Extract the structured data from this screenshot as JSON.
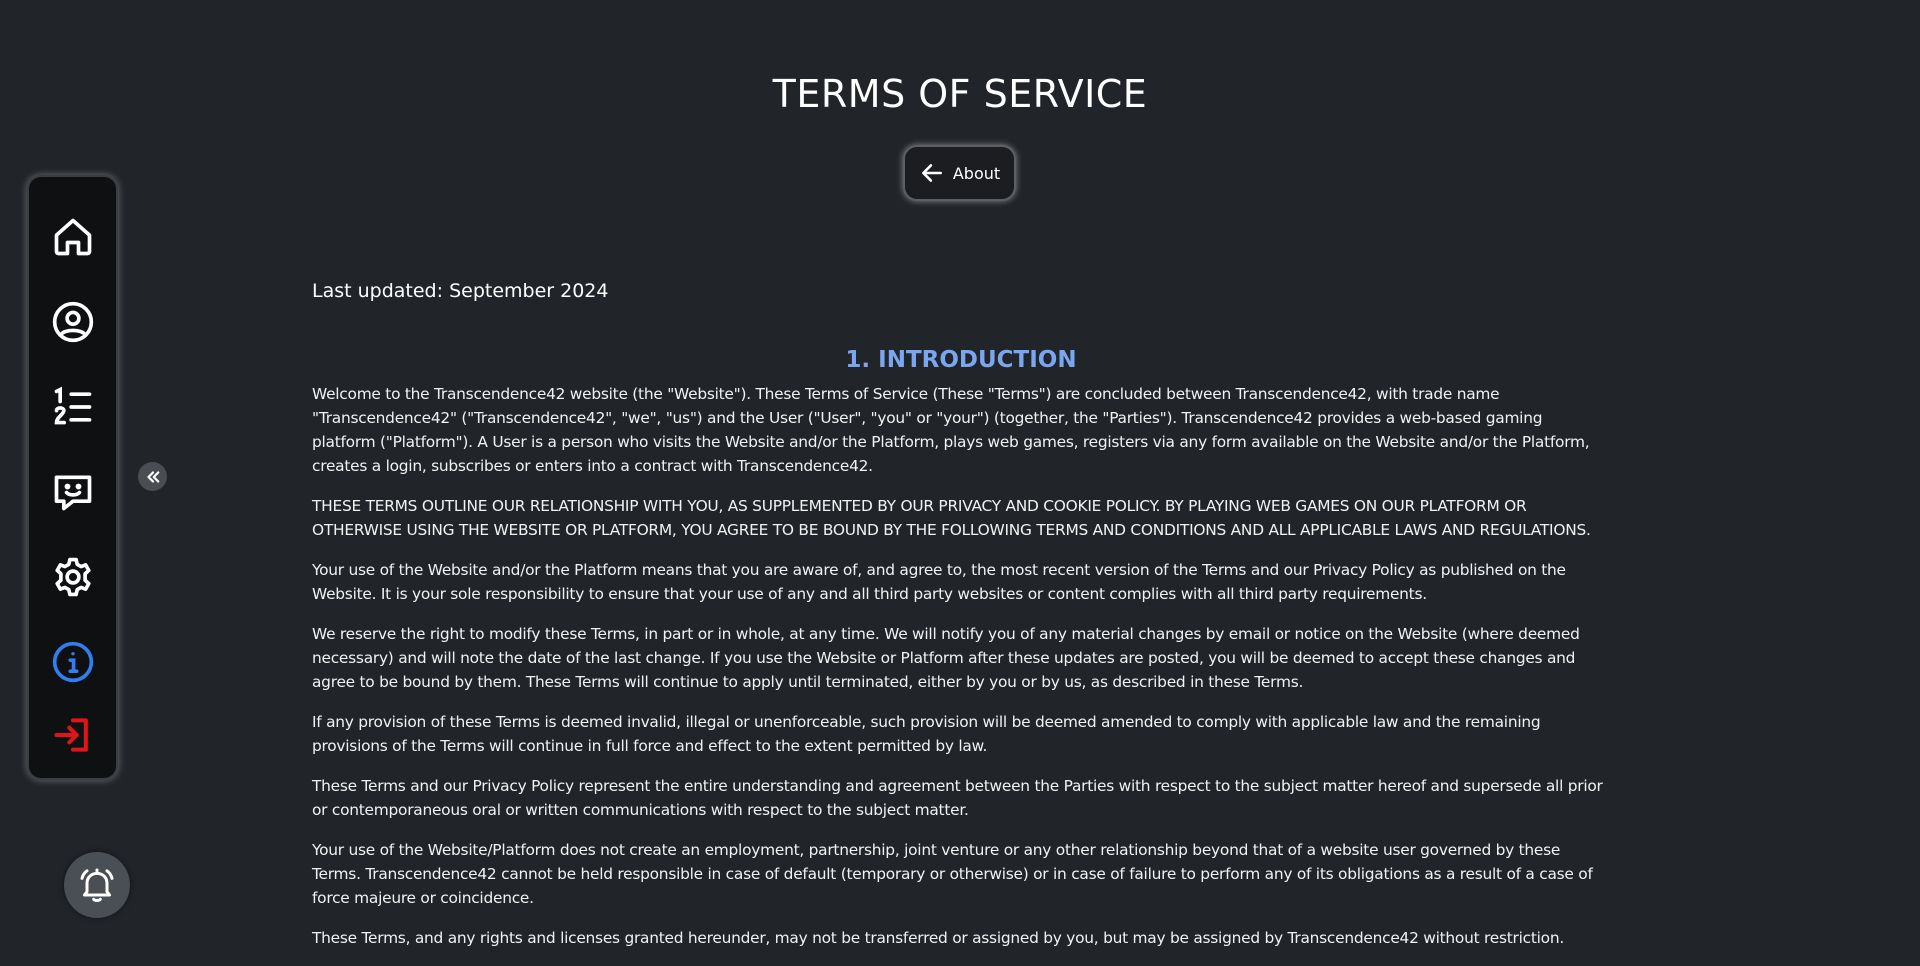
{
  "page": {
    "title": "TERMS OF SERVICE",
    "back_button_label": "About",
    "last_updated": "Last updated: September 2024"
  },
  "sidebar": {
    "items": [
      {
        "name": "home",
        "icon": "home-icon"
      },
      {
        "name": "profile",
        "icon": "user-circle-icon"
      },
      {
        "name": "leaderboard",
        "icon": "ranked-list-icon"
      },
      {
        "name": "chat",
        "icon": "chat-smile-icon"
      },
      {
        "name": "settings",
        "icon": "gear-icon"
      },
      {
        "name": "about",
        "icon": "info-icon",
        "active": true
      },
      {
        "name": "logout",
        "icon": "logout-icon"
      }
    ],
    "collapse_icon": "double-chevron-left-icon",
    "notification_icon": "bell-icon"
  },
  "colors": {
    "background": "#212429",
    "sidebar": "#0f1012",
    "section_title": "#7aa6f0",
    "info_active": "#2f7ff0",
    "logout": "#e0141b"
  },
  "section": {
    "title": "1. INTRODUCTION",
    "paragraphs": [
      "Welcome to the Transcendence42 website (the \"Website\"). These Terms of Service (These \"Terms\") are concluded between Transcendence42, with trade name \"Transcendence42\" (\"Transcendence42\", \"we\", \"us\") and the User (\"User\", \"you\" or \"your\") (together, the \"Parties\"). Transcendence42 provides a web-based gaming platform (\"Platform\"). A User is a person who visits the Website and/or the Platform, plays web games, registers via any form available on the Website and/or the Platform, creates a login, subscribes or enters into a contract with Transcendence42.",
      "THESE TERMS OUTLINE OUR RELATIONSHIP WITH YOU, AS SUPPLEMENTED BY OUR PRIVACY AND COOKIE POLICY. BY PLAYING WEB GAMES ON OUR PLATFORM OR OTHERWISE USING THE WEBSITE OR PLATFORM, YOU AGREE TO BE BOUND BY THE FOLLOWING TERMS AND CONDITIONS AND ALL APPLICABLE LAWS AND REGULATIONS.",
      "Your use of the Website and/or the Platform means that you are aware of, and agree to, the most recent version of the Terms and our Privacy Policy as published on the Website. It is your sole responsibility to ensure that your use of any and all third party websites or content complies with all third party requirements.",
      "We reserve the right to modify these Terms, in part or in whole, at any time. We will notify you of any material changes by email or notice on the Website (where deemed necessary) and will note the date of the last change. If you use the Website or Platform after these updates are posted, you will be deemed to accept these changes and agree to be bound by them. These Terms will continue to apply until terminated, either by you or by us, as described in these Terms.",
      "If any provision of these Terms is deemed invalid, illegal or unenforceable, such provision will be deemed amended to comply with applicable law and the remaining provisions of the Terms will continue in full force and effect to the extent permitted by law.",
      "These Terms and our Privacy Policy represent the entire understanding and agreement between the Parties with respect to the subject matter hereof and supersede all prior or contemporaneous oral or written communications with respect to the subject matter.",
      "Your use of the Website/Platform does not create an employment, partnership, joint venture or any other relationship beyond that of a website user governed by these Terms. Transcendence42 cannot be held responsible in case of default (temporary or otherwise) or in case of failure to perform any of its obligations as a result of a case of force majeure or coincidence.",
      "These Terms, and any rights and licenses granted hereunder, may not be transferred or assigned by you, but may be assigned by Transcendence42 without restriction."
    ]
  }
}
